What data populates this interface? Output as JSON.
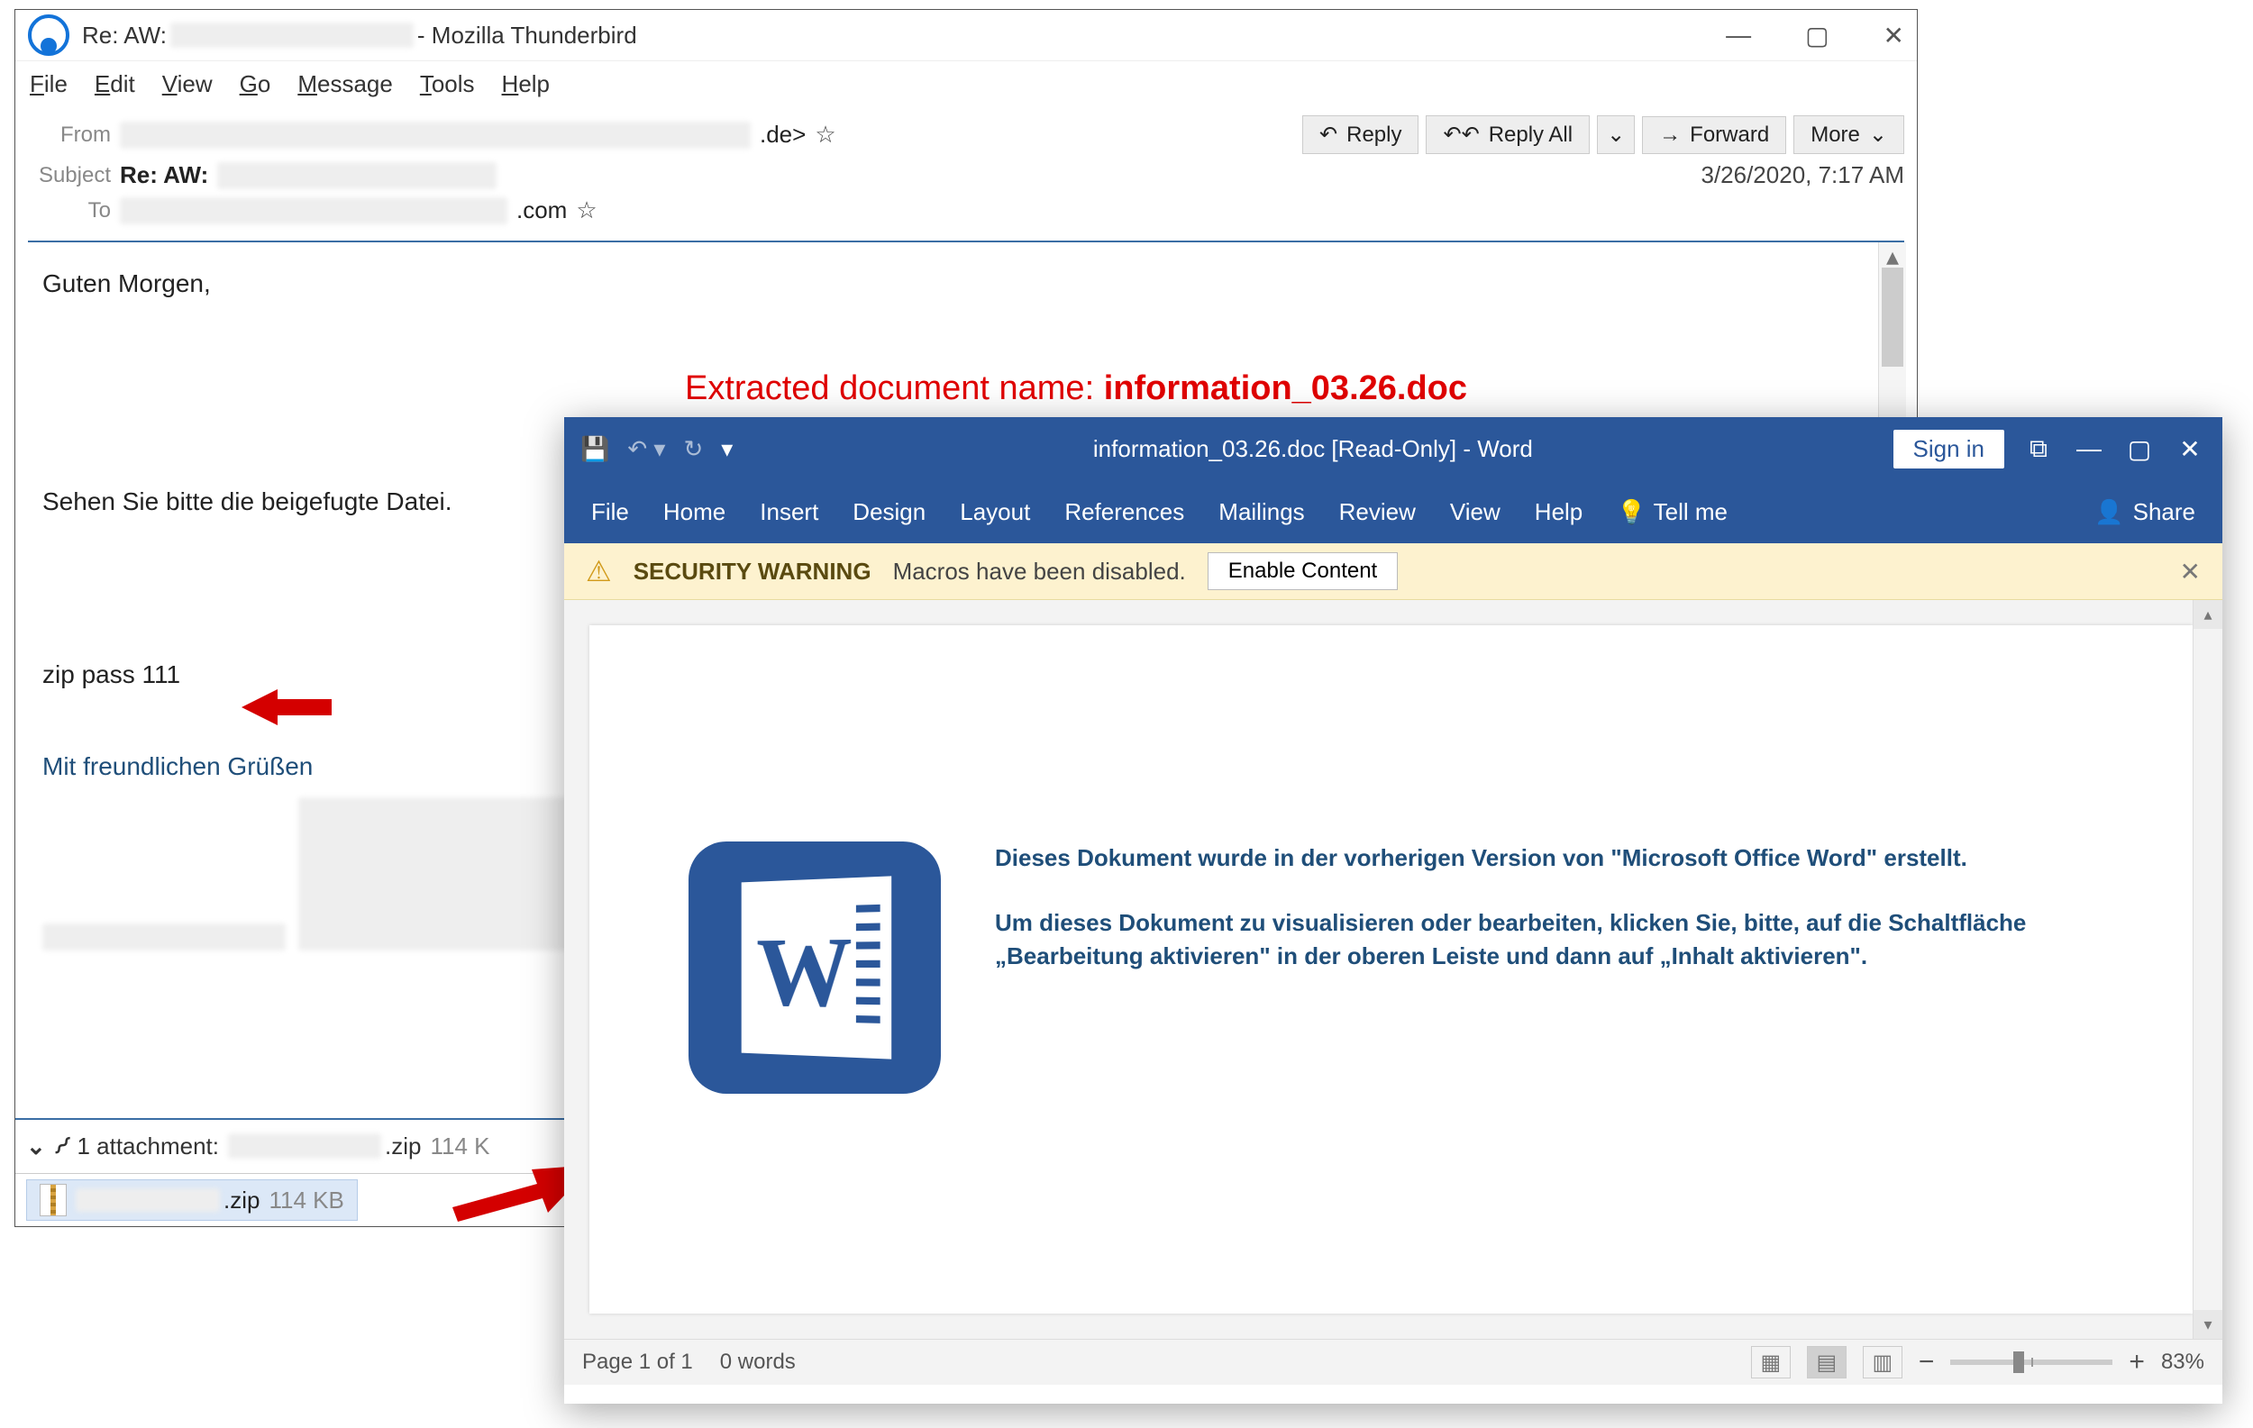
{
  "thunderbird": {
    "title_prefix": "Re: AW:",
    "title_suffix": "- Mozilla Thunderbird",
    "win": {
      "min": "—",
      "max": "▢",
      "close": "✕"
    },
    "menus": [
      "File",
      "Edit",
      "View",
      "Go",
      "Message",
      "Tools",
      "Help"
    ],
    "header": {
      "from_label": "From",
      "from_suffix": ".de>",
      "subject_label": "Subject",
      "subject_prefix": "Re: AW:",
      "to_label": "To",
      "to_suffix": ".com",
      "date": "3/26/2020, 7:17 AM",
      "actions": {
        "reply": "Reply",
        "reply_all": "Reply All",
        "forward": "Forward",
        "more": "More"
      }
    },
    "body": {
      "greeting": "Guten Morgen,",
      "line2": "Sehen Sie bitte die beigefugte Datei.",
      "pass": "zip pass 111",
      "sig": "Mit freundlichen Grüßen"
    },
    "attach": {
      "count_label": "1 attachment:",
      "ext": ".zip",
      "size_trunc": "114 K",
      "size": "114 KB"
    }
  },
  "annotation": {
    "label": "Extracted document name: ",
    "filename": "information_03.26.doc"
  },
  "word": {
    "qat_icons": [
      "save",
      "undo",
      "redo"
    ],
    "customize": "▾",
    "doc_title": "information_03.26.doc [Read-Only]  -  Word",
    "signin": "Sign in",
    "win": {
      "restore": "⧉",
      "min": "—",
      "max": "▢",
      "close": "✕"
    },
    "ribbon": [
      "File",
      "Home",
      "Insert",
      "Design",
      "Layout",
      "References",
      "Mailings",
      "Review",
      "View",
      "Help"
    ],
    "tell_me": "Tell me",
    "share": "Share",
    "warn": {
      "title": "SECURITY WARNING",
      "msg": "Macros have been disabled.",
      "btn": "Enable Content"
    },
    "page_text": {
      "p1": "Dieses Dokument wurde in der vorherigen Version von \"Microsoft Office Word\" erstellt.",
      "p2": "Um dieses Dokument zu visualisieren oder bearbeiten, klicken Sie, bitte, auf die Schaltfläche „Bearbeitung aktivieren\" in der oberen Leiste und dann auf „Inhalt aktivieren\"."
    },
    "status": {
      "page": "Page 1 of 1",
      "words": "0 words",
      "zoom": "83%"
    }
  }
}
